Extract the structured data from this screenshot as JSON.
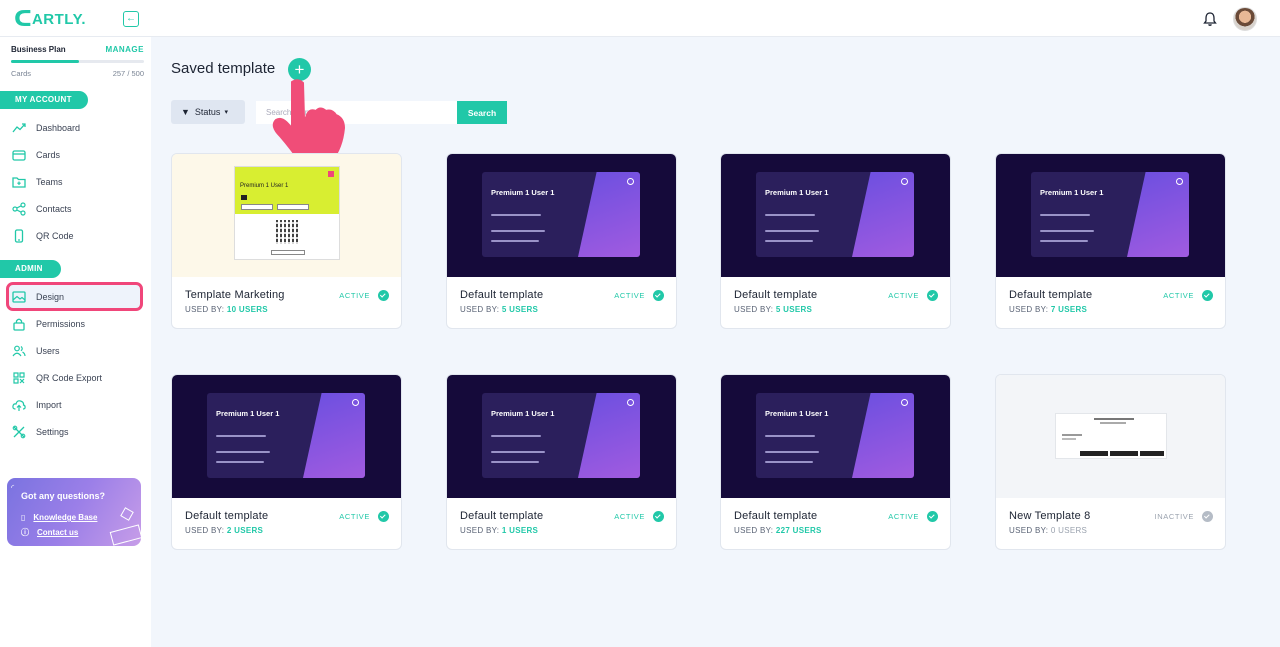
{
  "app": {
    "logo_text": "ARTLY."
  },
  "plan": {
    "name": "Business Plan",
    "manage_label": "MANAGE",
    "cards_label": "Cards",
    "cards_count": "257 / 500",
    "usage_fraction": 0.514
  },
  "sidebar": {
    "my_account_label": "MY ACCOUNT",
    "admin_label": "ADMIN",
    "account_items": [
      {
        "label": "Dashboard",
        "icon": "chart-line-icon"
      },
      {
        "label": "Cards",
        "icon": "card-icon"
      },
      {
        "label": "Teams",
        "icon": "folder-plus-icon"
      },
      {
        "label": "Contacts",
        "icon": "share-icon"
      },
      {
        "label": "QR Code",
        "icon": "phone-icon"
      }
    ],
    "admin_items": [
      {
        "label": "Design",
        "icon": "image-icon"
      },
      {
        "label": "Permissions",
        "icon": "lock-icon"
      },
      {
        "label": "Users",
        "icon": "users-icon"
      },
      {
        "label": "QR Code Export",
        "icon": "qr-code-icon"
      },
      {
        "label": "Import",
        "icon": "cloud-upload-icon"
      },
      {
        "label": "Settings",
        "icon": "tools-icon"
      }
    ],
    "help": {
      "title": "Got any questions?",
      "knowledge_base": "Knowledge Base",
      "contact_us": "Contact us"
    }
  },
  "main": {
    "title": "Saved template",
    "filter_label": "Status",
    "search_placeholder": "Search entry",
    "search_button": "Search"
  },
  "preview": {
    "card_name": "Premium 1 User 1"
  },
  "templates": [
    {
      "name": "Template Marketing",
      "used_by_label": "USED BY:",
      "users": "10 USERS",
      "status": "ACTIVE"
    },
    {
      "name": "Default template",
      "used_by_label": "USED BY:",
      "users": "5 USERS",
      "status": "ACTIVE"
    },
    {
      "name": "Default template",
      "used_by_label": "USED BY:",
      "users": "5 USERS",
      "status": "ACTIVE"
    },
    {
      "name": "Default template",
      "used_by_label": "USED BY:",
      "users": "7 USERS",
      "status": "ACTIVE"
    },
    {
      "name": "Default template",
      "used_by_label": "USED BY:",
      "users": "2 USERS",
      "status": "ACTIVE"
    },
    {
      "name": "Default template",
      "used_by_label": "USED BY:",
      "users": "1 USERS",
      "status": "ACTIVE"
    },
    {
      "name": "Default template",
      "used_by_label": "USED BY:",
      "users": "227 USERS",
      "status": "ACTIVE"
    },
    {
      "name": "New Template 8",
      "used_by_label": "USED BY:",
      "users": "0 USERS",
      "status": "INACTIVE"
    }
  ],
  "colors": {
    "accent": "#21c8a8",
    "highlight": "#f0467a",
    "dark_preview": "#150a3a"
  }
}
